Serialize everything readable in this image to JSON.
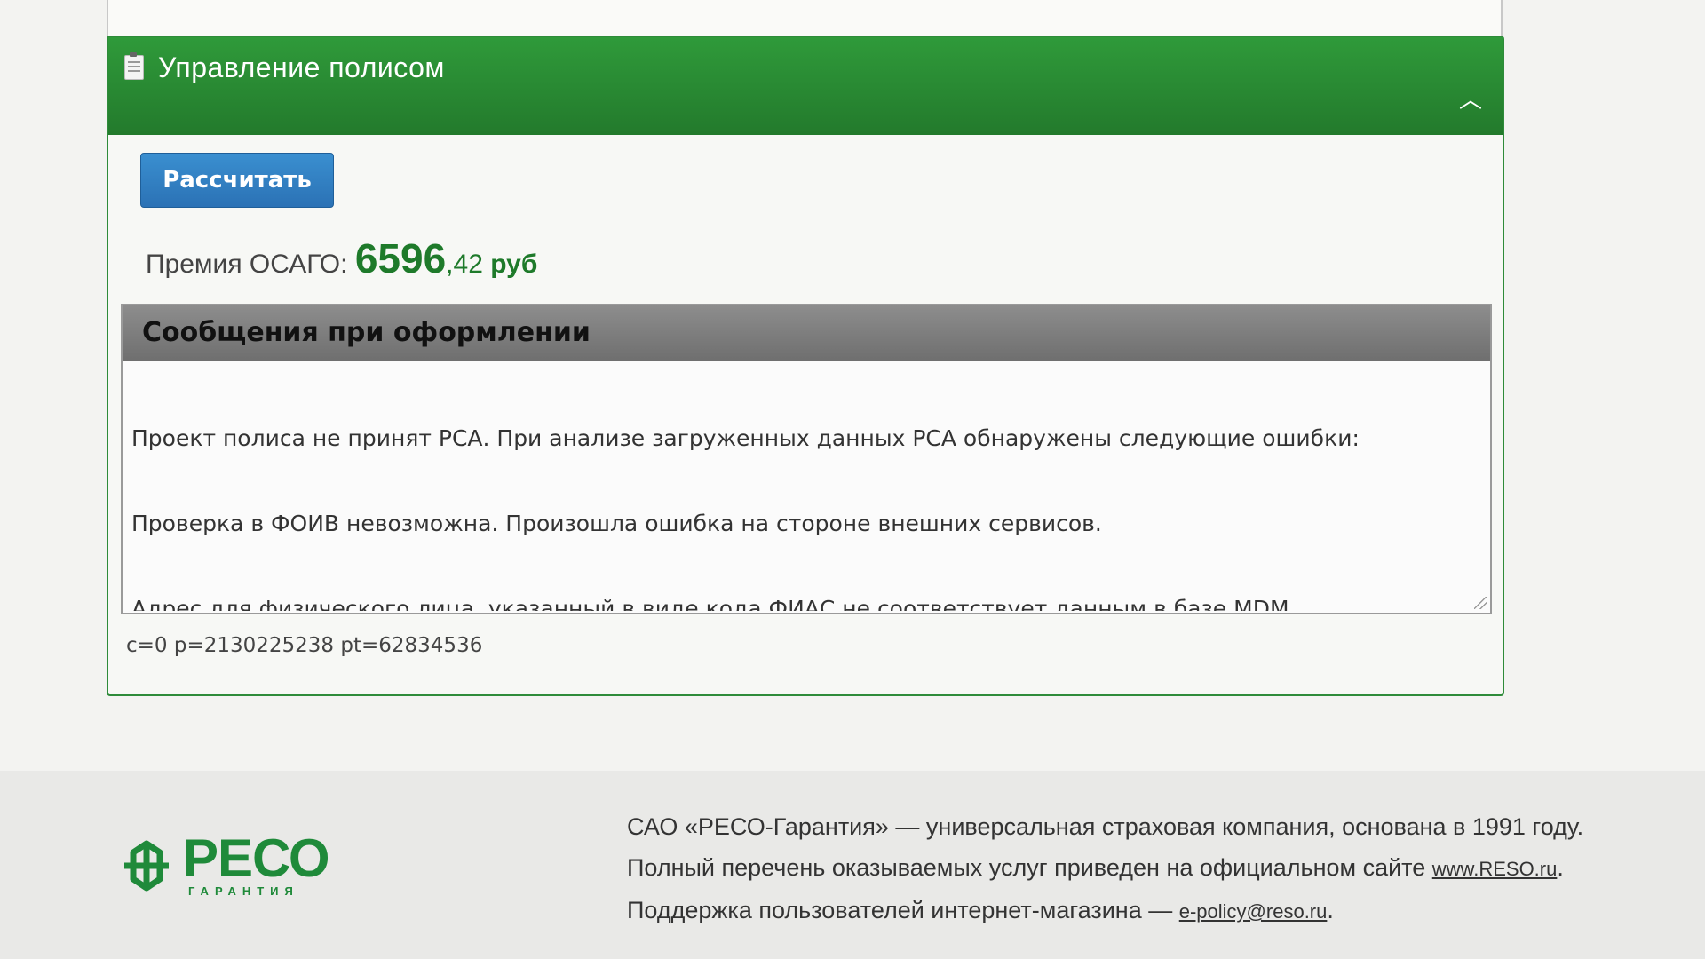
{
  "policy_panel": {
    "title": "Управление полисом",
    "calculate_button": "Рассчитать",
    "premium": {
      "label": "Премия ОСАГО:",
      "amount_integer": "6596",
      "amount_fraction": ",42",
      "currency": "руб"
    },
    "messages": {
      "header": "Сообщения при оформлении",
      "lines": [
        "Проект полиса не принят РСА. При анализе загруженных данных РСА обнаружены следующие ошибки:",
        "Проверка в ФОИВ невозможна. Произошла ошибка на стороне внешних сервисов.",
        "Адрес для физического лица, указанный в виде кода ФИАС не соответствует данным в базе MDM."
      ]
    },
    "debug_line": "c=0 p=2130225238 pt=62834536"
  },
  "footer": {
    "logo_word": "РЕСО",
    "logo_subtitle": "ГАРАНТИЯ",
    "line1": "САО «РЕСО-Гарантия» — универсальная страховая компания, основана в 1991 году.",
    "line2_text": "Полный перечень оказываемых услуг приведен на официальном сайте",
    "line2_link": "www.RESO.ru",
    "line2_end": ".",
    "line3_text": "Поддержка пользователей интернет-магазина —",
    "line3_link": "e-policy@reso.ru",
    "line3_end": "."
  },
  "colors": {
    "header_green": "#2f9a3a",
    "button_blue": "#2b72b5",
    "premium_green": "#1e7a2a",
    "logo_green": "#1f8a3a"
  }
}
